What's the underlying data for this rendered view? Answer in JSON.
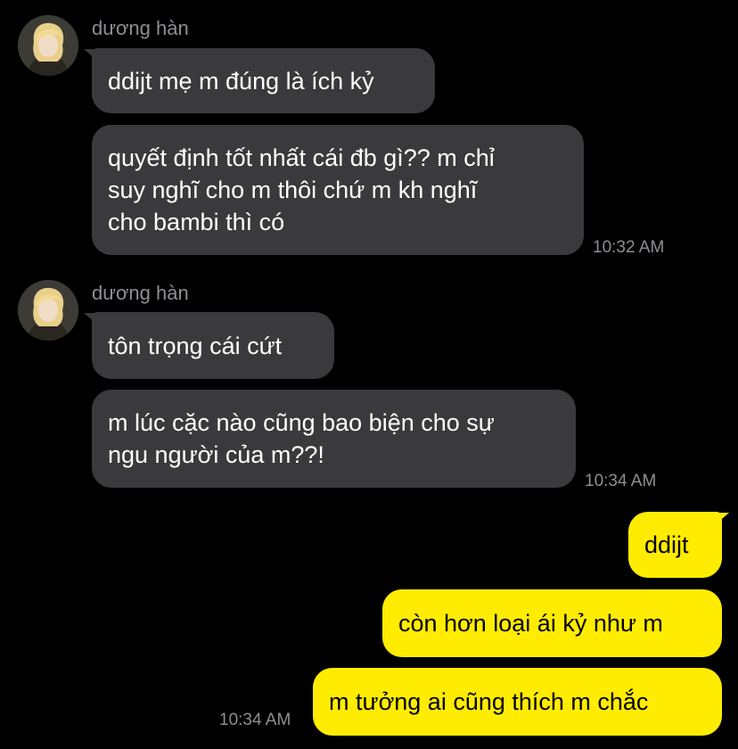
{
  "conversation": {
    "groups": [
      {
        "sender": "dương hàn",
        "avatar_icon": "user-avatar-icon",
        "messages": [
          "ddijt mẹ m đúng là ích kỷ",
          "quyết định tốt nhất cái đb gì?? m chỉ\nsuy nghĩ cho m thôi chứ m kh nghĩ\ncho bambi thì có"
        ],
        "time": "10:32 AM"
      },
      {
        "sender": "dương hàn",
        "avatar_icon": "user-avatar-icon",
        "messages": [
          "tôn trọng cái cứt",
          "m lúc cặc nào cũng bao biện cho sự\nngu người của m??!"
        ],
        "time": "10:34 AM"
      },
      {
        "sender": "",
        "messages": [
          "ddijt",
          "còn hơn loại ái kỷ như m",
          "m tưởng ai cũng thích m chắc"
        ],
        "time": "10:34 AM"
      }
    ]
  },
  "colors": {
    "background": "#000000",
    "incoming_bubble": "#3a3a3c",
    "outgoing_bubble": "#ffec00",
    "secondary_text": "#8e8e93"
  }
}
